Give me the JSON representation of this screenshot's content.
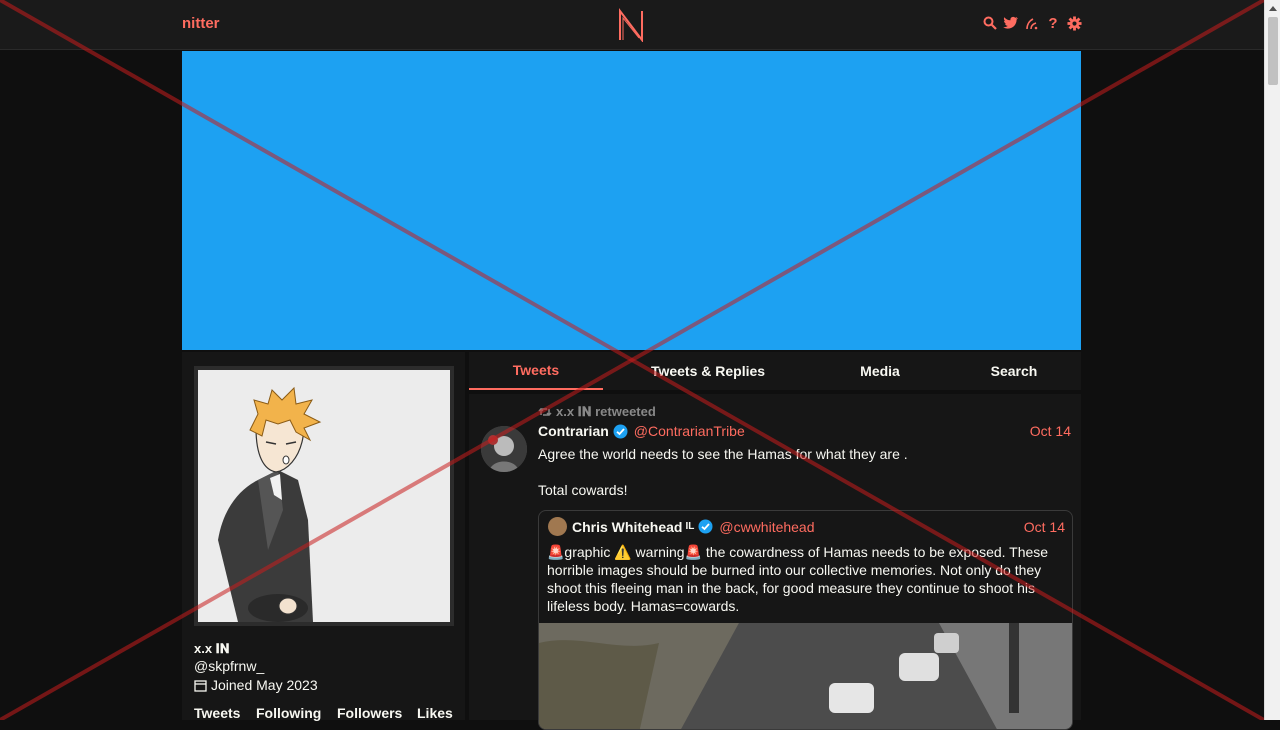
{
  "navbar": {
    "brand": "nitter",
    "icons": [
      "search-icon",
      "twitter-bird-icon",
      "rss-icon",
      "help-icon",
      "settings-icon"
    ],
    "help_glyph": "?"
  },
  "profile": {
    "fullname": "x.x 𝐈𝐍",
    "username": "@skpfrnw_",
    "joined": "Joined May 2023",
    "stats": [
      "Tweets",
      "Following",
      "Followers",
      "Likes"
    ]
  },
  "tabs": [
    {
      "label": "Tweets",
      "active": true
    },
    {
      "label": "Tweets & Replies",
      "active": false
    },
    {
      "label": "Media",
      "active": false
    },
    {
      "label": "Search",
      "active": false
    }
  ],
  "tweet": {
    "retweet_header": "x.x 𝐈𝐍 retweeted",
    "fullname": "Contrarian",
    "username": "@ContrarianTribe",
    "date": "Oct 14",
    "text": [
      "Agree the world needs to see the Hamas for what they are .",
      "Total cowards!"
    ]
  },
  "quote": {
    "fullname": "Chris Whitehead",
    "flag": "IL",
    "username": "@cwwhitehead",
    "date": "Oct 14",
    "text": "🚨graphic ⚠️ warning🚨 the cowardness of Hamas needs to be exposed. These horrible images should be burned into our collective memories. Not only do they shoot this fleeing man in the back, for good measure they continue to shoot his lifeless body. Hamas=cowards."
  },
  "colors": {
    "accent": "#ff6c60",
    "banner": "#1da1f2",
    "background": "#0f0f0f",
    "panel": "#161616",
    "verified": "#1da1f2"
  }
}
